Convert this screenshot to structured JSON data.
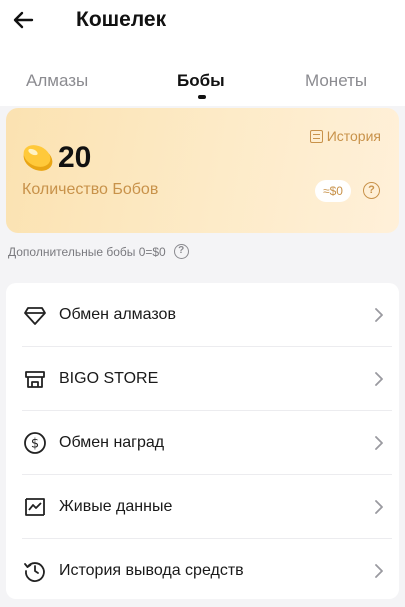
{
  "header": {
    "title": "Кошелек",
    "back_icon": "arrow-left-icon"
  },
  "tabs": [
    {
      "label": "Алмазы",
      "active": false
    },
    {
      "label": "Бобы",
      "active": true
    },
    {
      "label": "Монеты",
      "active": false
    }
  ],
  "bean_card": {
    "history_label": "История",
    "count": "20",
    "count_label": "Количество Бобов",
    "value_label": "≈$0",
    "colors": {
      "gradient_start": "#fbe2b1",
      "gradient_end": "#fff0d9",
      "accent": "#c8924a"
    }
  },
  "extra_beans_label": "Дополнительные бобы 0=$0",
  "menu": [
    {
      "label": "Обмен алмазов",
      "icon": "diamond-icon"
    },
    {
      "label": "BIGO STORE",
      "icon": "store-icon"
    },
    {
      "label": "Обмен наград",
      "icon": "dollar-circle-icon"
    },
    {
      "label": "Живые данные",
      "icon": "chart-icon"
    },
    {
      "label": "История вывода средств",
      "icon": "clock-history-icon"
    }
  ]
}
